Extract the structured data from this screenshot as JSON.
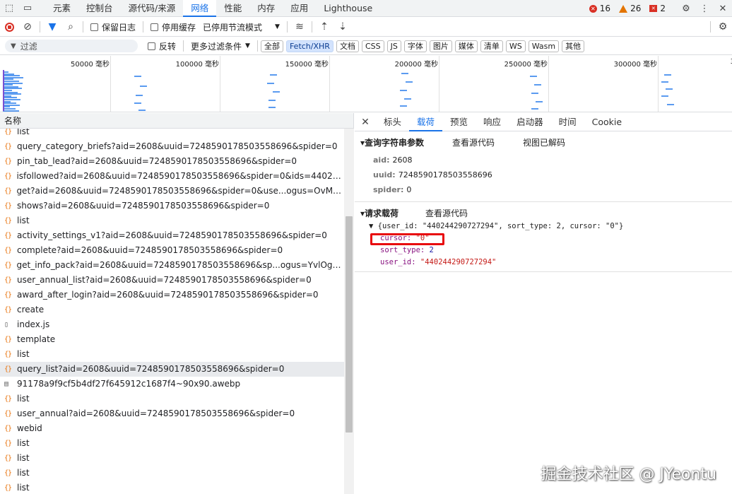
{
  "topbar": {
    "tabs": [
      "元素",
      "控制台",
      "源代码/来源",
      "网络",
      "性能",
      "内存",
      "应用",
      "Lighthouse"
    ],
    "active_tab": 3,
    "errors": "16",
    "warnings": "26",
    "issues": "2"
  },
  "toolbar": {
    "preserve_log": "保留日志",
    "disable_cache": "停用缓存",
    "throttle": "已停用节流模式"
  },
  "filter": {
    "placeholder": "过滤",
    "invert": "反转",
    "more_filters": "更多过滤条件",
    "types": [
      "全部",
      "Fetch/XHR",
      "文档",
      "CSS",
      "JS",
      "字体",
      "图片",
      "媒体",
      "清单",
      "WS",
      "Wasm",
      "其他"
    ],
    "active_type": 1
  },
  "overview": {
    "labels": [
      "50000 毫秒",
      "100000 毫秒",
      "150000 毫秒",
      "200000 毫秒",
      "250000 毫秒",
      "300000 毫秒",
      "3"
    ]
  },
  "list": {
    "header": "名称",
    "rows": [
      {
        "name": "list",
        "type": "xhr"
      },
      {
        "name": "query_category_briefs?aid=2608&uuid=7248590178503558696&spider=0",
        "type": "xhr"
      },
      {
        "name": "pin_tab_lead?aid=2608&uuid=7248590178503558696&spider=0",
        "type": "xhr"
      },
      {
        "name": "isfollowed?aid=2608&uuid=7248590178503558696&spider=0&ids=4402442...",
        "type": "xhr"
      },
      {
        "name": "get?aid=2608&uuid=7248590178503558696&spider=0&use...ogus=OvMOgc...",
        "type": "xhr"
      },
      {
        "name": "shows?aid=2608&uuid=7248590178503558696&spider=0",
        "type": "xhr"
      },
      {
        "name": "list",
        "type": "xhr"
      },
      {
        "name": "activity_settings_v1?aid=2608&uuid=7248590178503558696&spider=0",
        "type": "xhr"
      },
      {
        "name": "complete?aid=2608&uuid=7248590178503558696&spider=0",
        "type": "xhr"
      },
      {
        "name": "get_info_pack?aid=2608&uuid=7248590178503558696&sp...ogus=YvlOgchL...",
        "type": "xhr"
      },
      {
        "name": "user_annual_list?aid=2608&uuid=7248590178503558696&spider=0",
        "type": "xhr"
      },
      {
        "name": "award_after_login?aid=2608&uuid=7248590178503558696&spider=0",
        "type": "xhr"
      },
      {
        "name": "create",
        "type": "xhr"
      },
      {
        "name": "index.js",
        "type": "doc"
      },
      {
        "name": "template",
        "type": "xhr"
      },
      {
        "name": "list",
        "type": "xhr"
      },
      {
        "name": "query_list?aid=2608&uuid=7248590178503558696&spider=0",
        "type": "xhr",
        "selected": true
      },
      {
        "name": "91178a9f9cf5b4df27f645912c1687f4~90x90.awebp",
        "type": "img"
      },
      {
        "name": "list",
        "type": "xhr"
      },
      {
        "name": "user_annual?aid=2608&uuid=7248590178503558696&spider=0",
        "type": "xhr"
      },
      {
        "name": "webid",
        "type": "xhr"
      },
      {
        "name": "list",
        "type": "xhr"
      },
      {
        "name": "list",
        "type": "xhr"
      },
      {
        "name": "list",
        "type": "xhr"
      },
      {
        "name": "list",
        "type": "xhr"
      }
    ]
  },
  "detail": {
    "tabs": [
      "标头",
      "载荷",
      "预览",
      "响应",
      "启动器",
      "时间",
      "Cookie"
    ],
    "active_tab": 1,
    "query_section": "▾查询字符串参数",
    "view_source": "查看源代码",
    "view_decoded": "视图已解码",
    "query_params": [
      {
        "k": "aid:",
        "v": "2608"
      },
      {
        "k": "uuid:",
        "v": "7248590178503558696"
      },
      {
        "k": "spider:",
        "v": "0"
      }
    ],
    "payload_section": "▾请求载荷",
    "payload_view_source": "查看源代码",
    "payload_summary": "▼ {user_id: \"440244290727294\", sort_type: 2, cursor: \"0\"}",
    "cursor_key": "cursor:",
    "cursor_val": "\"0\"",
    "sort_key": "sort_type:",
    "sort_val": "2",
    "user_key": "user_id:",
    "user_val": "\"440244290727294\""
  },
  "watermark": "掘金技术社区 @ JYeontu"
}
